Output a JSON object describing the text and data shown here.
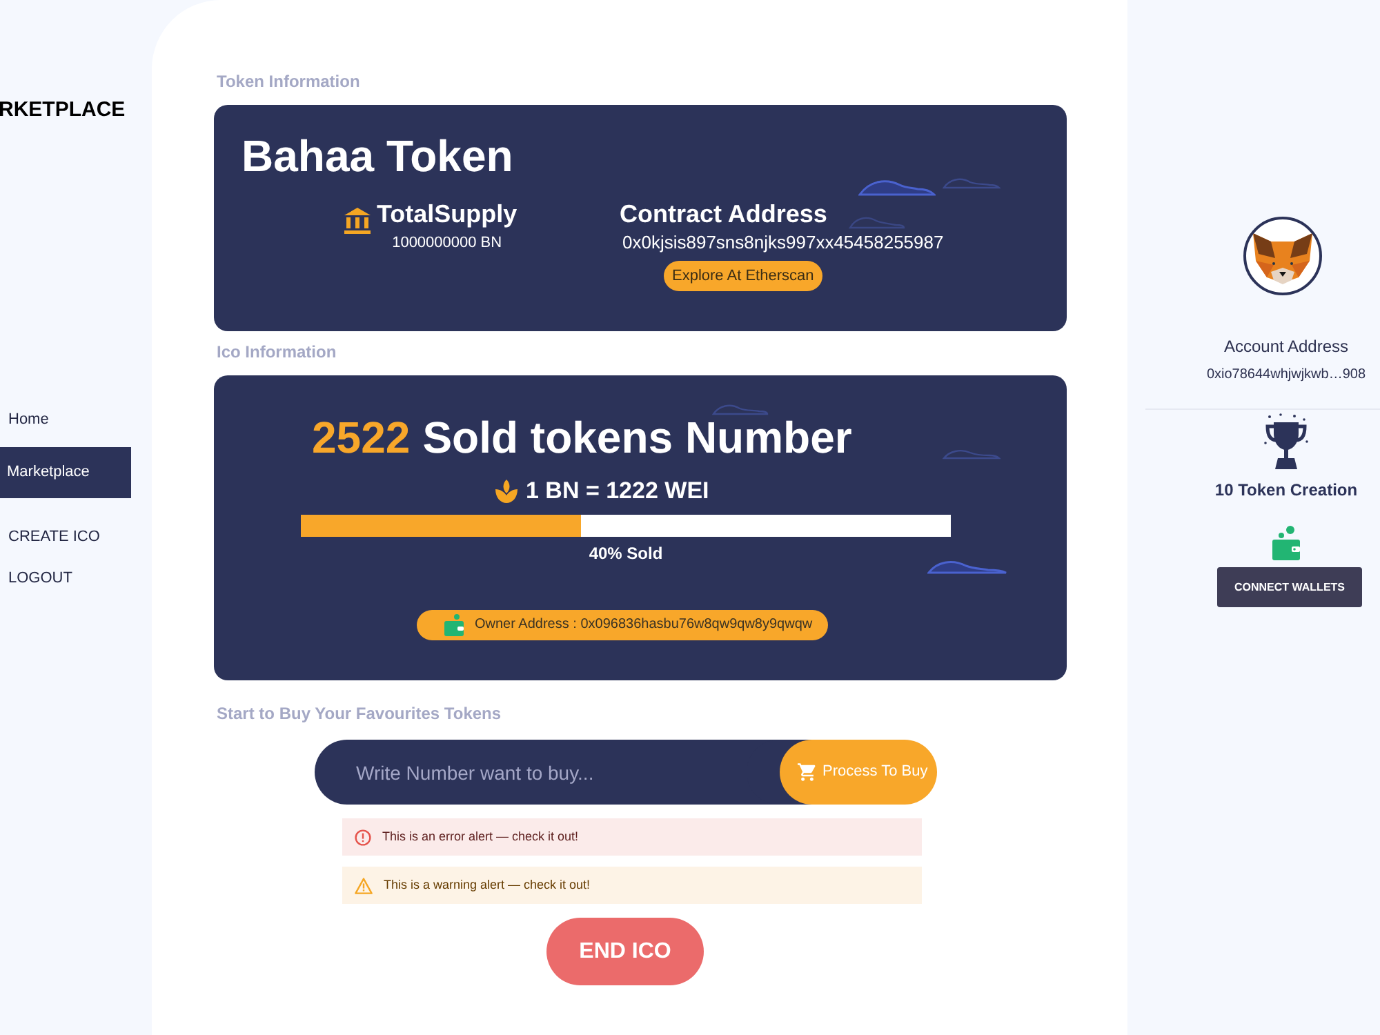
{
  "sidebar": {
    "logo": "RKETPLACE",
    "items": [
      {
        "label": "Home",
        "selected": false
      },
      {
        "label": "Marketplace",
        "selected": true
      },
      {
        "label": "CREATE ICO",
        "selected": false
      },
      {
        "label": "LOGOUT",
        "selected": false
      }
    ]
  },
  "token_information": {
    "heading": "Token Information",
    "name": "Bahaa Token",
    "total_supply": {
      "label": "TotalSupply",
      "value": "1000000000 BN"
    },
    "contract": {
      "label": "Contract Address",
      "address": "0x0kjsis897sns8njks997xx45458255987",
      "button": "Explore At Etherscan"
    }
  },
  "ico_information": {
    "heading": "Ico Information",
    "sold_count": "2522",
    "sold_label": "Sold tokens Number",
    "rate": "1 BN = 1222 WEI",
    "progress": {
      "level": 0.43,
      "label": "40% Sold"
    },
    "owner": "Owner Address : 0x096836hasbu76w8qw9qw8y9qwqw"
  },
  "buy": {
    "heading": "Start to Buy Your Favourites Tokens",
    "input": {
      "placeholder": "Write Number want to buy..."
    },
    "button": "Process To Buy",
    "alerts": [
      {
        "kind": "error",
        "text": "This is an error alert — check it out!"
      },
      {
        "kind": "warning",
        "text": "This is a warning alert — check it out!"
      }
    ],
    "end_button": "END ICO"
  },
  "account": {
    "label": "Account Address",
    "address": "0xio78644whjwjkwb…908",
    "token_creation": "10 Token Creation",
    "connect_button": "CONNECT WALLETS"
  }
}
